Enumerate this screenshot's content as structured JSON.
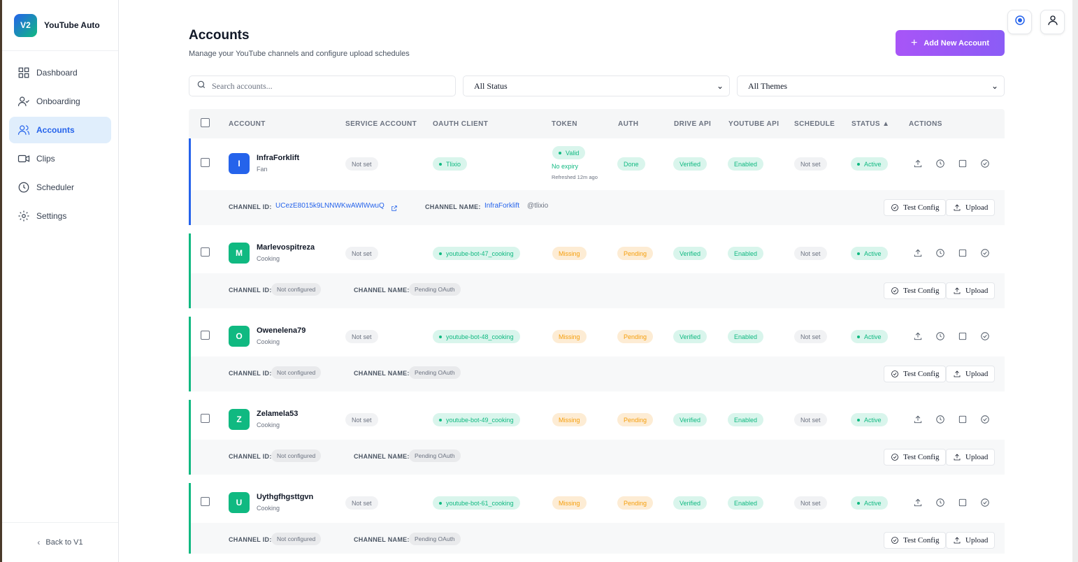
{
  "app": {
    "logo_text": "V2",
    "name": "YouTube Auto"
  },
  "sidebar": {
    "items": [
      {
        "label": "Dashboard",
        "icon": "grid-icon",
        "active": false
      },
      {
        "label": "Onboarding",
        "icon": "user-check-icon",
        "active": false
      },
      {
        "label": "Accounts",
        "icon": "users-icon",
        "active": true
      },
      {
        "label": "Clips",
        "icon": "video-icon",
        "active": false
      },
      {
        "label": "Scheduler",
        "icon": "clock-icon",
        "active": false
      },
      {
        "label": "Settings",
        "icon": "gear-icon",
        "active": false
      }
    ],
    "footer": "Back to V1"
  },
  "header": {
    "title": "Accounts",
    "subtitle": "Manage your YouTube channels and configure upload schedules",
    "add_button": "Add New Account"
  },
  "filters": {
    "search_placeholder": "Search accounts...",
    "status": "All Status",
    "themes": "All Themes"
  },
  "table": {
    "columns": [
      "ACCOUNT",
      "SERVICE ACCOUNT",
      "OAUTH CLIENT",
      "TOKEN",
      "AUTH",
      "DRIVE API",
      "YOUTUBE API",
      "SCHEDULE",
      "STATUS ▲",
      "ACTIONS"
    ],
    "sub_labels": {
      "channel_id": "CHANNEL ID:",
      "channel_name": "CHANNEL NAME:"
    },
    "sub_buttons": {
      "test": "Test Config",
      "upload": "Upload"
    },
    "rows": [
      {
        "initial": "I",
        "name": "InfraForklift",
        "theme": "Fan",
        "service": "Not set",
        "oauth": "Tlixio",
        "token": "Valid",
        "token_expiry": "No expiry",
        "token_refreshed": "Refreshed 12m ago",
        "auth": "Done",
        "drive": "Verified",
        "youtube": "Enabled",
        "schedule": "Not set",
        "status": "Active",
        "channel_id": "UCezE8015k9LNNWKwAWlWwuQ",
        "channel_name": "InfraForklift",
        "channel_handle": "@tlixio"
      },
      {
        "initial": "M",
        "name": "Marlevospitreza",
        "theme": "Cooking",
        "service": "Not set",
        "oauth": "youtube-bot-47_cooking",
        "token": "Missing",
        "auth": "Pending",
        "drive": "Verified",
        "youtube": "Enabled",
        "schedule": "Not set",
        "status": "Active",
        "channel_id": "Not configured",
        "channel_name": "Pending OAuth"
      },
      {
        "initial": "O",
        "name": "Owenelena79",
        "theme": "Cooking",
        "service": "Not set",
        "oauth": "youtube-bot-48_cooking",
        "token": "Missing",
        "auth": "Pending",
        "drive": "Verified",
        "youtube": "Enabled",
        "schedule": "Not set",
        "status": "Active",
        "channel_id": "Not configured",
        "channel_name": "Pending OAuth"
      },
      {
        "initial": "Z",
        "name": "Zelamela53",
        "theme": "Cooking",
        "service": "Not set",
        "oauth": "youtube-bot-49_cooking",
        "token": "Missing",
        "auth": "Pending",
        "drive": "Verified",
        "youtube": "Enabled",
        "schedule": "Not set",
        "status": "Active",
        "channel_id": "Not configured",
        "channel_name": "Pending OAuth"
      },
      {
        "initial": "U",
        "name": "Uythgfhgsttgvn",
        "theme": "Cooking",
        "service": "Not set",
        "oauth": "youtube-bot-61_cooking",
        "token": "Missing",
        "auth": "Pending",
        "drive": "Verified",
        "youtube": "Enabled",
        "schedule": "Not set",
        "status": "Active",
        "channel_id": "Not configured",
        "channel_name": "Pending OAuth"
      }
    ]
  },
  "colors": {
    "primary": "#2563eb",
    "accent_purple": "#a855f7",
    "success": "#10b981",
    "warning": "#f59e0b",
    "avatar_first": "#2563eb",
    "avatar_rest": "#10b981"
  }
}
